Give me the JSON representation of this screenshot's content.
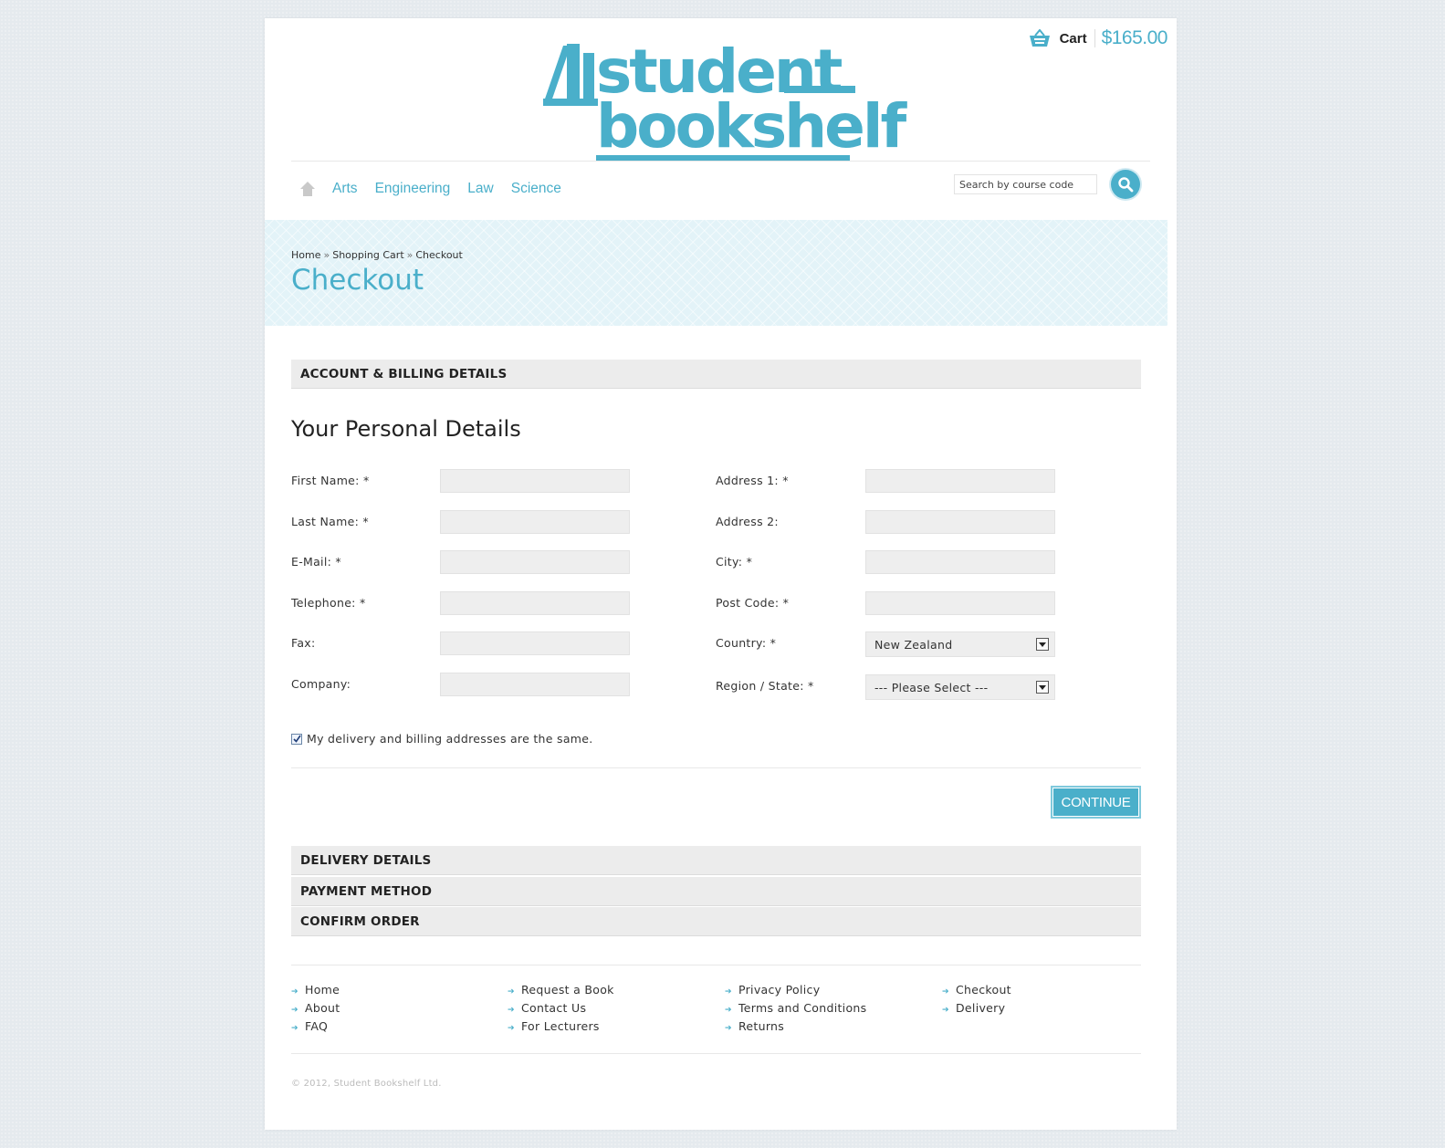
{
  "header": {
    "logo_line1": "student",
    "logo_line2": "bookshelf",
    "cart_label": "Cart",
    "cart_total": "$165.00"
  },
  "nav": {
    "items": [
      {
        "label": "Arts"
      },
      {
        "label": "Engineering"
      },
      {
        "label": "Law"
      },
      {
        "label": "Science"
      }
    ],
    "search_placeholder": "Search by course code"
  },
  "banner": {
    "breadcrumb": [
      "Home",
      "Shopping Cart",
      "Checkout"
    ],
    "title": "Checkout"
  },
  "sections": {
    "account": "ACCOUNT & BILLING DETAILS",
    "delivery": "DELIVERY DETAILS",
    "payment": "PAYMENT METHOD",
    "confirm": "CONFIRM ORDER"
  },
  "form": {
    "title": "Your Personal Details",
    "left_fields": [
      {
        "label": "First Name: *",
        "value": ""
      },
      {
        "label": "Last Name: *",
        "value": ""
      },
      {
        "label": "E-Mail: *",
        "value": ""
      },
      {
        "label": "Telephone: *",
        "value": ""
      },
      {
        "label": "Fax:",
        "value": ""
      },
      {
        "label": "Company:",
        "value": ""
      }
    ],
    "right_fields": [
      {
        "label": "Address 1: *",
        "value": ""
      },
      {
        "label": "Address 2:",
        "value": ""
      },
      {
        "label": "City: *",
        "value": ""
      },
      {
        "label": "Post Code: *",
        "value": ""
      }
    ],
    "country_label": "Country: *",
    "country_value": "New Zealand",
    "region_label": "Region / State: *",
    "region_value": "--- Please Select ---",
    "same_address_label": "My delivery and billing addresses are the same.",
    "same_address_checked": true,
    "continue_label": "CONTINUE"
  },
  "footer": {
    "columns": [
      [
        "Home",
        "About",
        "FAQ"
      ],
      [
        "Request a Book",
        "Contact Us",
        "For Lecturers"
      ],
      [
        "Privacy Policy",
        "Terms and Conditions",
        "Returns"
      ],
      [
        "Checkout",
        "Delivery"
      ]
    ],
    "copyright": "© 2012, Student Bookshelf Ltd."
  },
  "colors": {
    "accent": "#4aafca",
    "section_bg": "#ececec",
    "input_bg": "#eeeeee"
  },
  "icons": [
    "cart-icon",
    "home-icon",
    "search-icon",
    "dropdown-arrow-icon",
    "checkmark-icon",
    "arrow-bullet-icon"
  ]
}
